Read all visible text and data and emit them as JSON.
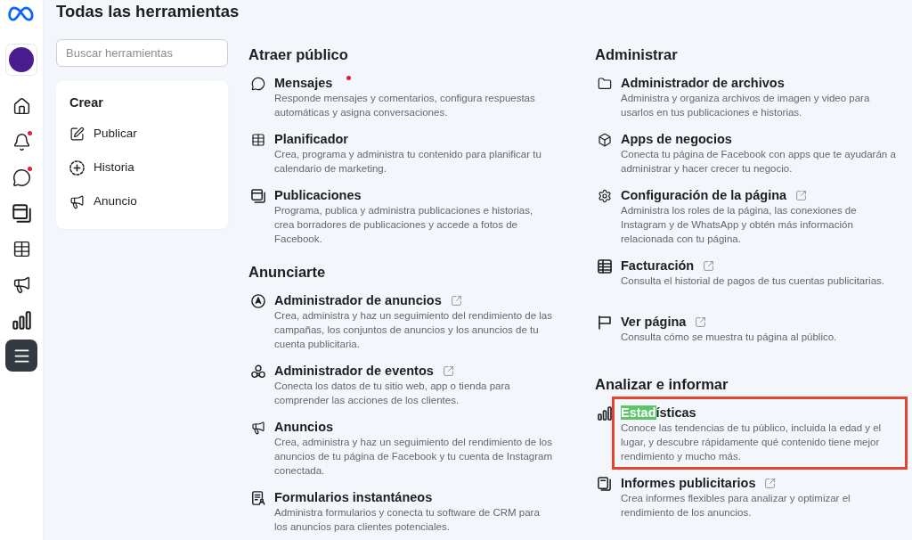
{
  "rail": {
    "items": [
      {
        "kind": "home",
        "badge": false,
        "selected": false
      },
      {
        "kind": "bell",
        "badge": true,
        "selected": false
      },
      {
        "kind": "chat",
        "badge": true,
        "selected": false
      },
      {
        "kind": "posts",
        "badge": false,
        "selected": false
      },
      {
        "kind": "table",
        "badge": false,
        "selected": false
      },
      {
        "kind": "megaphone",
        "badge": false,
        "selected": false
      },
      {
        "kind": "chart",
        "badge": false,
        "selected": false
      },
      {
        "kind": "menu",
        "badge": false,
        "selected": true
      }
    ]
  },
  "title": "Todas las herramientas",
  "search": {
    "placeholder": "Buscar herramientas"
  },
  "create_card": {
    "title": "Crear",
    "items": [
      {
        "kind": "edit",
        "label": "Publicar"
      },
      {
        "kind": "story",
        "label": "Historia"
      },
      {
        "kind": "megaphone",
        "label": "Anuncio"
      }
    ]
  },
  "columns": [
    {
      "sections": [
        {
          "heading": "Atraer público",
          "tools": [
            {
              "kind": "chat",
              "title": "Mensajes",
              "description": "Responde mensajes y comentarios, configura respuestas automáticas y asigna conversaciones.",
              "notification": true,
              "external": false,
              "framed": false
            },
            {
              "kind": "table",
              "title": "Planificador",
              "description": "Crea, programa y administra tu contenido para planificar tu calendario de marketing.",
              "notification": false,
              "external": false,
              "framed": false
            },
            {
              "kind": "posts",
              "title": "Publicaciones",
              "description": "Programa, publica y administra publicaciones e historias, crea borradores de publicaciones y accede a fotos de Facebook.",
              "notification": false,
              "external": false,
              "framed": false
            }
          ]
        },
        {
          "heading": "Anunciarte",
          "tools": [
            {
              "kind": "compass",
              "title": "Administrador de anuncios",
              "description": "Crea, administra y haz un seguimiento del rendimiento de las campañas, los conjuntos de anuncios y los anuncios de tu cuenta publicitaria.",
              "notification": false,
              "external": true,
              "framed": false
            },
            {
              "kind": "events",
              "title": "Administrador de eventos",
              "description": "Conecta los datos de tu sitio web, app o tienda para comprender las acciones de los clientes.",
              "notification": false,
              "external": true,
              "framed": false
            },
            {
              "kind": "megaphone",
              "title": "Anuncios",
              "description": "Crea, administra y haz un seguimiento del rendimiento de los anuncios de tu página de Facebook y tu cuenta de Instagram conectada.",
              "notification": false,
              "external": false,
              "framed": false
            },
            {
              "kind": "form",
              "title": "Formularios instantáneos",
              "description": "Administra formularios y conecta tu software de CRM para los anuncios para clientes potenciales.",
              "notification": false,
              "external": false,
              "framed": false
            }
          ]
        }
      ]
    },
    {
      "sections": [
        {
          "heading": "Administrar",
          "tools": [
            {
              "kind": "folder",
              "title": "Administrador de archivos",
              "description": "Administra y organiza archivos de imagen y video para usarlos en tus publicaciones e historias.",
              "notification": false,
              "external": false,
              "framed": false
            },
            {
              "kind": "cube",
              "title": "Apps de negocios",
              "description": "Conecta tu página de Facebook con apps que te ayudarán a administrar y hacer crecer tu negocio.",
              "notification": false,
              "external": false,
              "framed": false
            },
            {
              "kind": "gear",
              "title": "Configuración de la página",
              "description": "Administra los roles de la página, las conexiones de Instagram y de WhatsApp y obtén más información relacionada con tu página.",
              "notification": false,
              "external": true,
              "framed": false
            },
            {
              "kind": "ledger",
              "title": "Facturación",
              "description": "Consulta el historial de pagos de tus cuentas publicitarias.",
              "notification": false,
              "external": true,
              "framed": false
            },
            {
              "kind": "flag",
              "title": "Ver página",
              "description": "Consulta cómo se muestra tu página al público.",
              "notification": false,
              "external": true,
              "framed": false
            }
          ]
        },
        {
          "heading": "Analizar e informar",
          "tools": [
            {
              "kind": "chart",
              "match": "Estad",
              "title": "ísticas",
              "description": "Conoce las tendencias de tu público, incluida la edad y el lugar, y descubre rápidamente qué contenido tiene mejor rendimiento y mucho más.",
              "notification": false,
              "external": false,
              "framed": true
            },
            {
              "kind": "reports",
              "title": "Informes publicitarios",
              "description": "Crea informes flexibles para analizar y optimizar el rendimiento de los anuncios.",
              "notification": false,
              "external": true,
              "framed": false
            }
          ]
        }
      ]
    }
  ]
}
